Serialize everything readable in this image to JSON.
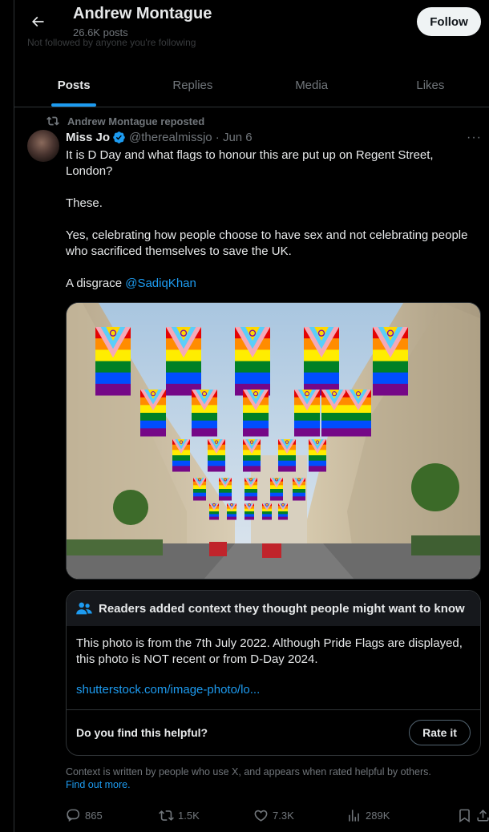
{
  "header": {
    "name": "Andrew Montague",
    "post_count": "26.6K posts",
    "faded_text": "Not followed by anyone you're following",
    "follow_label": "Follow"
  },
  "tabs": [
    {
      "label": "Posts",
      "active": true
    },
    {
      "label": "Replies",
      "active": false
    },
    {
      "label": "Media",
      "active": false
    },
    {
      "label": "Likes",
      "active": false
    }
  ],
  "post": {
    "repost_text": "Andrew Montague reposted",
    "author": "Miss Jo",
    "handle_date": "@therealmissjo · Jun 6",
    "text1": "It is D Day and what flags to honour this are put up on Regent Street, London?",
    "text2": "These.",
    "text3": "Yes, celebrating how people choose to have sex and not celebrating people who sacrificed themselves to save the UK.",
    "text4_prefix": "A disgrace ",
    "mention": "@SadiqKhan",
    "more_label": "···"
  },
  "note": {
    "heading": "Readers added context they thought people might want to know",
    "body": "This photo is from the 7th July 2022. Although Pride Flags are displayed, this photo is NOT recent or from D-Day 2024.",
    "link": "shutterstock.com/image-photo/lo...",
    "question": "Do you find this helpful?",
    "rate_label": "Rate it"
  },
  "context": {
    "text": "Context is written by people who use X, and appears when rated helpful by others.",
    "link": "Find out more."
  },
  "actions": {
    "replies": "865",
    "reposts": "1.5K",
    "likes": "7.3K",
    "views": "289K"
  },
  "colors": {
    "accent": "#1d9bf0",
    "background": "#000000",
    "text": "#e7e9ea",
    "muted": "#71767b",
    "border": "#2f3336"
  },
  "icons": [
    "back-arrow-icon",
    "repost-icon",
    "verified-badge-icon",
    "more-icon",
    "people-icon",
    "reply-icon",
    "retweet-icon",
    "like-icon",
    "views-icon",
    "bookmark-icon",
    "share-icon"
  ]
}
